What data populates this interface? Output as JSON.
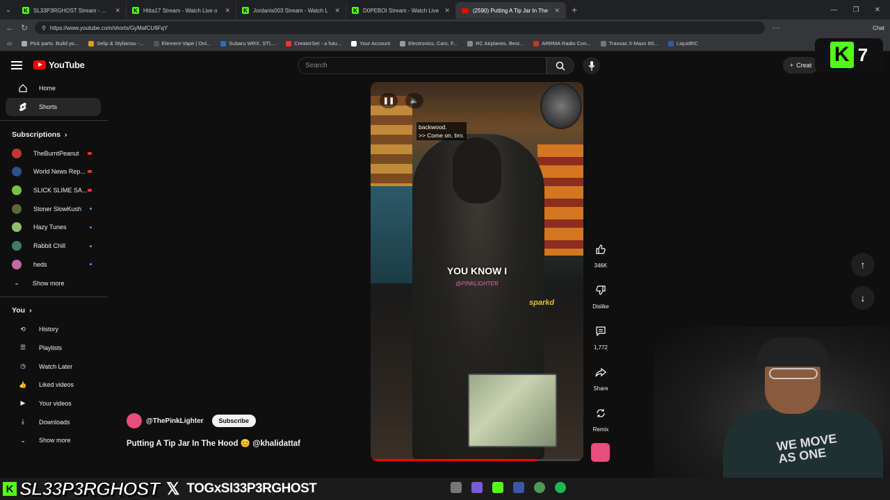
{
  "browser": {
    "tabs": [
      {
        "title": "SL33P3RGHOST Stream - Watch",
        "icon": "kick"
      },
      {
        "title": "Hitta17 Stream - Watch Live o",
        "icon": "kick"
      },
      {
        "title": "Jordanis003 Stream - Watch L",
        "icon": "kick"
      },
      {
        "title": "D0PEBOI Stream - Watch Live",
        "icon": "kick"
      },
      {
        "title": "(2590) Putting A Tip Jar In The",
        "icon": "youtube",
        "active": true
      }
    ],
    "url": "https://www.youtube.com/shorts/GyMafCU6FqY",
    "chat_label": "Chat",
    "bookmarks": [
      "Pick parts. Build yo...",
      "Selip & Stylianou -...",
      "Element Vape | Onl...",
      "Subaru WRX, STI,...",
      "CreatorSet - a futu...",
      "Your Account",
      "Electronics, Cars, F...",
      "RC Airplanes, Best...",
      "ARRMA Radio Con...",
      "Traxxas X-Maxx 8S...",
      "LiquidRC"
    ]
  },
  "youtube": {
    "logo_text": "YouTube",
    "search_placeholder": "Search",
    "create_label": "Creat",
    "sidebar": {
      "main": [
        {
          "label": "Home",
          "icon": "home-icon"
        },
        {
          "label": "Shorts",
          "icon": "shorts-icon",
          "active": true
        }
      ],
      "subscriptions_header": "Subscriptions",
      "subscriptions": [
        {
          "name": "TheBurntPeanut",
          "status": "live",
          "color": "#c0392b"
        },
        {
          "name": "World News Rep...",
          "status": "live",
          "color": "#2e4f8a"
        },
        {
          "name": "SLICK SLIME SA...",
          "status": "live",
          "color": "#7ac142"
        },
        {
          "name": "Stoner SlowKush",
          "status": "new",
          "color": "#5a6b3a"
        },
        {
          "name": "Hazy Tunes",
          "status": "new",
          "color": "#8fbf6a"
        },
        {
          "name": "Rabbit Chill",
          "status": "new",
          "color": "#3f7f5f"
        },
        {
          "name": "heds",
          "status": "new",
          "color": "#c46ba3"
        }
      ],
      "show_more_1": "Show more",
      "you_header": "You",
      "you_items": [
        {
          "label": "History",
          "icon": "history-icon"
        },
        {
          "label": "Playlists",
          "icon": "playlists-icon"
        },
        {
          "label": "Watch Later",
          "icon": "watch-later-icon"
        },
        {
          "label": "Liked videos",
          "icon": "like-icon"
        },
        {
          "label": "Your videos",
          "icon": "your-videos-icon"
        },
        {
          "label": "Downloads",
          "icon": "download-icon"
        }
      ],
      "show_more_2": "Show more"
    },
    "short": {
      "caption_small_1": "backwood.",
      "caption_small_2": ">> Come on, bro.",
      "caption_big": "YOU KNOW I",
      "watermark": "@PINKLIGHTER",
      "store_brand": "sparkd",
      "progress": 0.78,
      "likes": "346K",
      "dislike_label": "Dislike",
      "comments": "1,772",
      "share_label": "Share",
      "remix_label": "Remix",
      "channel": "@ThePinkLighter",
      "subscribe_label": "Subscribe",
      "title": "Putting A Tip Jar In The Hood 😊 @khalidattaf"
    }
  },
  "overlay": {
    "kick_badge_letter": "K",
    "kick_badge_number": "7",
    "stream_name": "SL33P3RGHOST",
    "x_handle": "TOGxSl33P3RGHOST",
    "shirt_text": "WE MOVE\nAS ONE"
  }
}
